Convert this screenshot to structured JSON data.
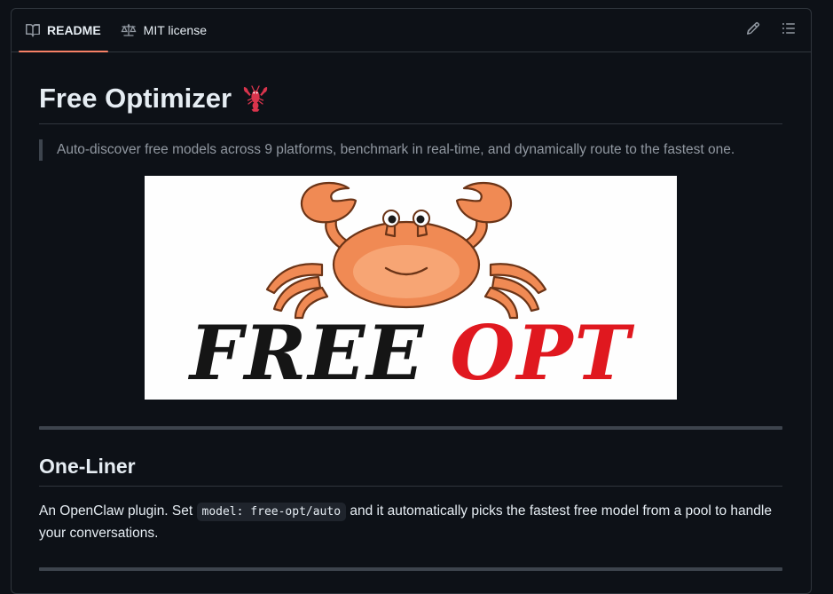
{
  "tabs": [
    {
      "label": "README",
      "icon": "book-icon",
      "active": true
    },
    {
      "label": "MIT license",
      "icon": "scale-icon",
      "active": false
    }
  ],
  "toolbar": {
    "edit_icon": "pencil-icon",
    "outline_icon": "list-icon"
  },
  "readme": {
    "title": "Free Optimizer",
    "title_emoji": "lobster-icon",
    "tagline": "Auto-discover free models across 9 platforms, benchmark in real-time, and dynamically route to the fastest one.",
    "logo": {
      "word1": "FREE",
      "word2": "OPT",
      "mascot": "crab-icon",
      "word1_color": "#151515",
      "word2_color": "#e0181f"
    },
    "section1": {
      "heading": "One-Liner",
      "text_before": "An OpenClaw plugin. Set ",
      "code": "model: free-opt/auto",
      "text_after": " and it automatically picks the fastest free model from a pool to handle your conversations."
    }
  },
  "colors": {
    "background": "#0d1117",
    "border": "#30363d",
    "tab_underline": "#f78166",
    "muted_text": "#9198a1"
  }
}
